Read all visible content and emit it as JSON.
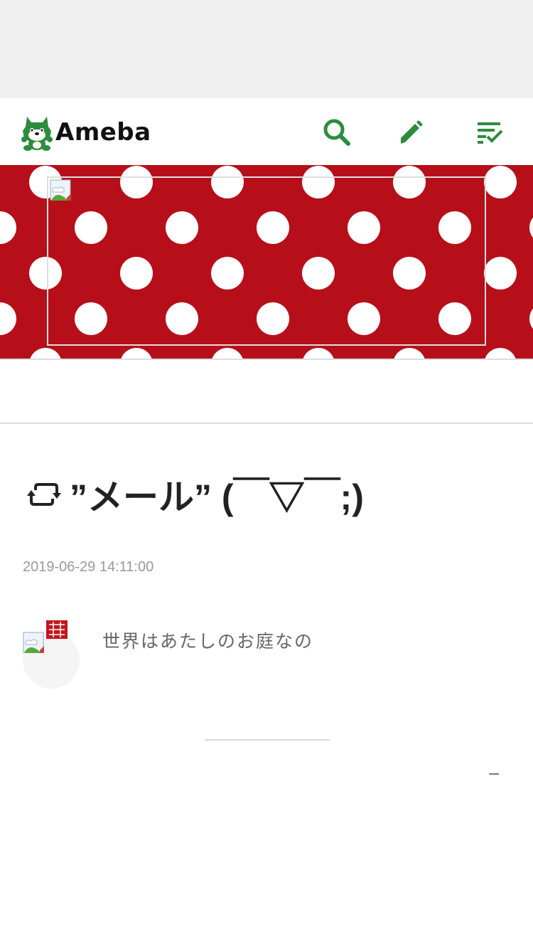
{
  "header": {
    "logo_text": "Ameba",
    "icons": [
      "search-icon",
      "pencil-icon",
      "checklist-icon"
    ]
  },
  "colors": {
    "brand_green": "#2d8c3c",
    "banner_red": "#b60f1a"
  },
  "article": {
    "title": "”メール” (￣▽￣;)",
    "date": "2019-06-29 14:11:00"
  },
  "author": {
    "description": "世界はあたしのお庭なの"
  },
  "footer": {
    "dash": "–"
  }
}
